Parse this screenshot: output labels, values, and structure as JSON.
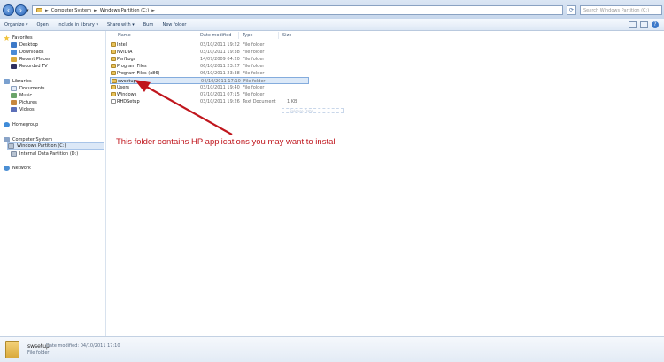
{
  "address": {
    "crumbs": [
      "Computer System",
      "Windows Partition (C:)"
    ],
    "search_placeholder": "Search Windows Partition (C:)"
  },
  "toolbar": {
    "organize": "Organize ▾",
    "open": "Open",
    "include_library": "Include in library ▾",
    "share_with": "Share with ▾",
    "burn": "Burn",
    "new_folder": "New folder"
  },
  "nav": {
    "favorites": "Favorites",
    "desktop": "Desktop",
    "downloads": "Downloads",
    "recent_places": "Recent Places",
    "recorded_tv": "Recorded TV",
    "libraries": "Libraries",
    "documents": "Documents",
    "music": "Music",
    "pictures": "Pictures",
    "videos": "Videos",
    "homegroup": "Homegroup",
    "computer": "Computer System",
    "drive_c": "Windows Partition (C:)",
    "drive_d": "Internal Data Partition (D:)",
    "network": "Network"
  },
  "columns": {
    "name": "Name",
    "date": "Date modified",
    "type": "Type",
    "size": "Size"
  },
  "files": [
    {
      "name": "Intel",
      "date": "03/10/2011 19:22",
      "type": "File folder",
      "size": ""
    },
    {
      "name": "NVIDIA",
      "date": "03/10/2011 19:38",
      "type": "File folder",
      "size": ""
    },
    {
      "name": "PerfLogs",
      "date": "14/07/2009 04:20",
      "type": "File folder",
      "size": ""
    },
    {
      "name": "Program Files",
      "date": "06/10/2011 23:27",
      "type": "File folder",
      "size": ""
    },
    {
      "name": "Program Files (x86)",
      "date": "06/10/2011 23:38",
      "type": "File folder",
      "size": ""
    },
    {
      "name": "swsetup",
      "date": "04/10/2011 17:10",
      "type": "File folder",
      "size": ""
    },
    {
      "name": "Users",
      "date": "03/10/2011 19:40",
      "type": "File folder",
      "size": ""
    },
    {
      "name": "Windows",
      "date": "07/10/2011 07:15",
      "type": "File folder",
      "size": ""
    },
    {
      "name": "RHDSetup",
      "date": "03/10/2011 19:26",
      "type": "Text Document",
      "size": "1 KB"
    }
  ],
  "selected_file": "swsetup",
  "drag_ghost_label": "Release Date",
  "annotation": "This folder contains HP applications you may want to install",
  "details": {
    "name": "swsetup",
    "meta": "Date modified: 04/10/2011 17:10",
    "type": "File folder"
  },
  "colors": {
    "annotation": "#c0161d",
    "selection": "#dce9f8"
  }
}
